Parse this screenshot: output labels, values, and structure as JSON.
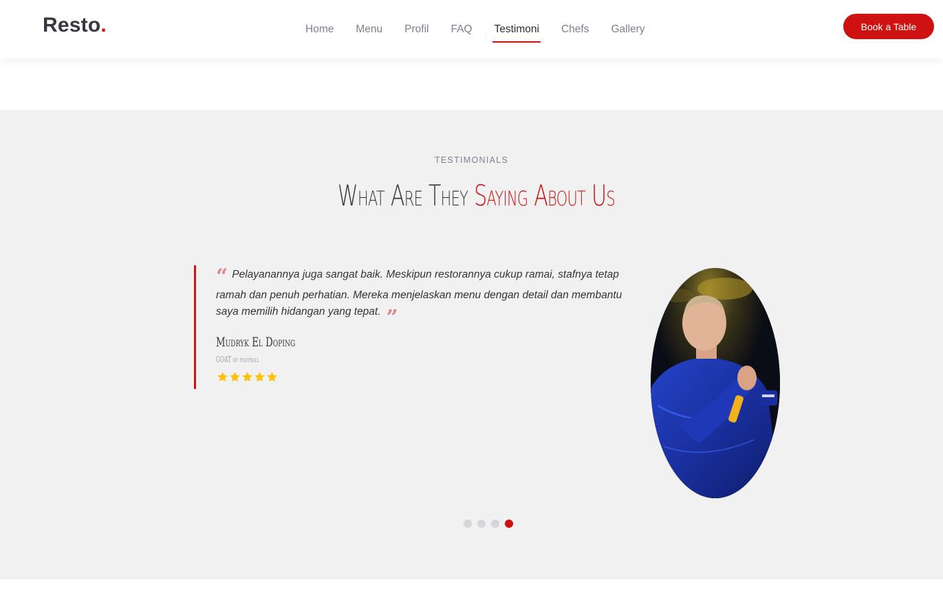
{
  "header": {
    "logo_text": "Resto",
    "logo_dot": ".",
    "nav": [
      {
        "label": "Home"
      },
      {
        "label": "Menu"
      },
      {
        "label": "Profil"
      },
      {
        "label": "FAQ"
      },
      {
        "label": "Testimoni"
      },
      {
        "label": "Chefs"
      },
      {
        "label": "Gallery"
      }
    ],
    "active_nav": "Testimoni",
    "cta_label": "Book a Table"
  },
  "testimonials": {
    "label": "Testimonials",
    "title_part1": "What Are They ",
    "title_part2": "Saying About Us",
    "quote": "Pelayanannya juga sangat baik. Meskipun restorannya cukup ramai, stafnya tetap ramah dan penuh perhatian. Mereka menjelaskan menu dengan detail dan membantu saya memilih hidangan yang tepat.",
    "author_name": "Mudryk El Doping",
    "author_role": "GOAT of football",
    "rating": 5,
    "slides": 4,
    "active_slide": 4
  },
  "colors": {
    "accent": "#ce1212",
    "section_bg": "#f2f1f1",
    "star": "#ffc107",
    "quote_icon": "#e08585"
  },
  "icons": {
    "quote_open": "quote-left-icon",
    "quote_close": "quote-right-icon",
    "star": "star-icon"
  }
}
